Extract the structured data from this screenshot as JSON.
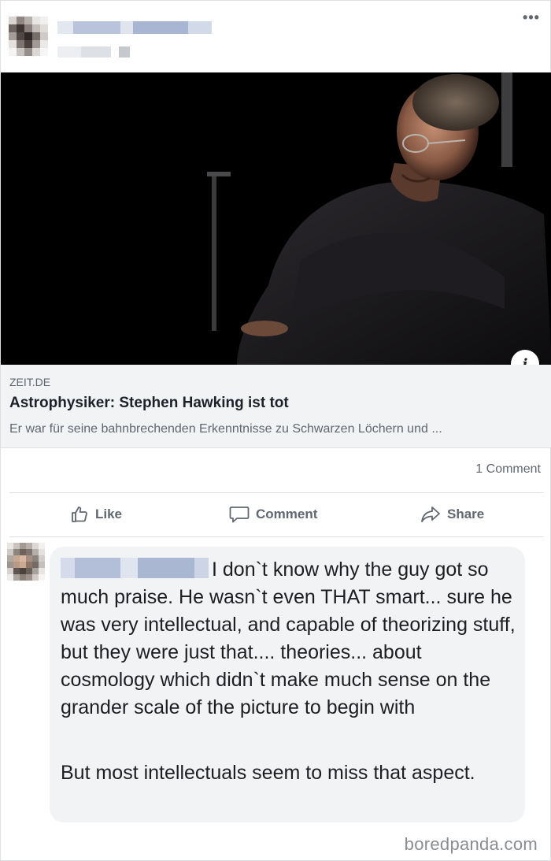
{
  "post": {
    "more_label": "•••",
    "info_label": "i",
    "link": {
      "domain": "ZEIT.DE",
      "title": "Astrophysiker: Stephen Hawking ist tot",
      "description": "Er war für seine bahnbrechenden Erkenntnisse zu Schwarzen Löchern und ..."
    },
    "comment_count": "1 Comment",
    "actions": {
      "like": "Like",
      "comment": "Comment",
      "share": "Share"
    }
  },
  "comment": {
    "paragraph1": "I don`t know why the guy got so much praise. He wasn`t even THAT smart... sure he was very intellectual, and capable of theorizing stuff, but they were just that.... theories... about cosmology which didn`t make much sense on the grander scale of the picture to begin with",
    "paragraph2": "But most intellectuals seem to miss that aspect."
  },
  "watermark": "boredpanda.com",
  "colors": {
    "secondary_text": "#606770",
    "bubble_bg": "#f2f3f5",
    "link_bg": "#f2f3f5"
  }
}
